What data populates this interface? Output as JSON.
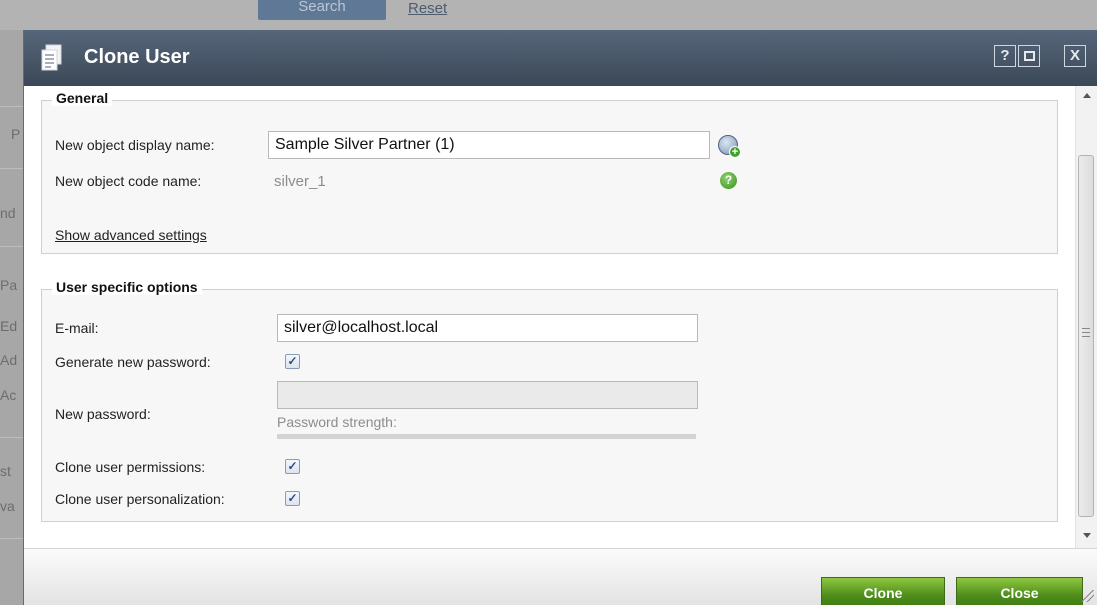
{
  "background": {
    "search_button": "Search",
    "reset_link": "Reset",
    "fragments": [
      "P",
      "nd",
      "Pa",
      "Ed",
      "Ad",
      "Ac",
      "st",
      "va"
    ]
  },
  "dialog": {
    "title": "Clone User",
    "title_buttons": {
      "help": "?",
      "close": "X"
    }
  },
  "general": {
    "legend": "General",
    "display_name_label": "New object display name:",
    "display_name_value": "Sample Silver Partner (1)",
    "code_name_label": "New object code name:",
    "code_name_value": "silver_1",
    "advanced_link": "Show advanced settings"
  },
  "user_options": {
    "legend": "User specific options",
    "email_label": "E-mail:",
    "email_value": "silver@localhost.local",
    "generate_password_label": "Generate new password:",
    "generate_password_checked": true,
    "new_password_label": "New password:",
    "new_password_value": "",
    "password_strength_label": "Password strength:",
    "clone_permissions_label": "Clone user permissions:",
    "clone_permissions_checked": true,
    "clone_personalization_label": "Clone user personalization:",
    "clone_personalization_checked": true
  },
  "footer": {
    "clone_label": "Clone",
    "close_label": "Close"
  },
  "colors": {
    "titlebar": "#4a5869",
    "action_button": "#5a9a22"
  }
}
